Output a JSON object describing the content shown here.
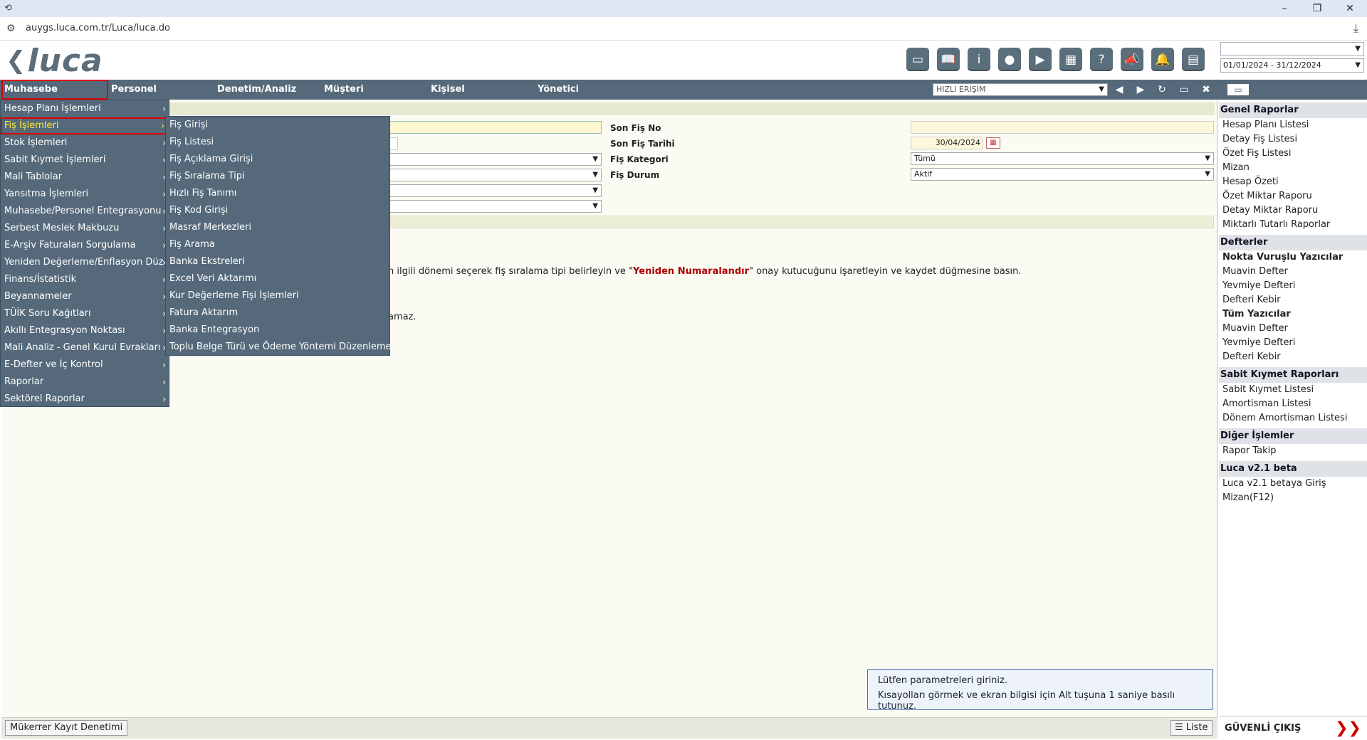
{
  "browser": {
    "url": "auygs.luca.com.tr/Luca/luca.do",
    "app_icon": "luca-app-icon"
  },
  "header": {
    "logo_text": "luca",
    "period_select_empty": "",
    "period_range": "01/01/2024 - 31/12/2024"
  },
  "toolbar": [
    {
      "name": "note-icon",
      "glyph": "▭"
    },
    {
      "name": "book-icon",
      "glyph": "📖"
    },
    {
      "name": "info-icon",
      "glyph": "i"
    },
    {
      "name": "globe-icon",
      "glyph": "●"
    },
    {
      "name": "youtube-icon",
      "glyph": "▶"
    },
    {
      "name": "calculator-icon",
      "glyph": "▦"
    },
    {
      "name": "help-icon",
      "glyph": "?"
    },
    {
      "name": "megaphone-icon",
      "glyph": "📣"
    },
    {
      "name": "bell-icon",
      "glyph": "🔔"
    },
    {
      "name": "notebook-icon",
      "glyph": "▤"
    }
  ],
  "menubar": {
    "items": [
      "Muhasebe",
      "Personel",
      "Denetim/Analiz",
      "Müşteri",
      "Kişisel",
      "Yönetici"
    ],
    "quick_access_placeholder": "HIZLI ERİŞİM"
  },
  "menu_level1": [
    {
      "label": "Hesap Planı İşlemleri",
      "sub": true
    },
    {
      "label": "Fiş İşlemleri",
      "sub": true,
      "active": true
    },
    {
      "label": "Stok İşlemleri",
      "sub": true
    },
    {
      "label": "Sabit Kıymet İşlemleri",
      "sub": true
    },
    {
      "label": "Mali Tablolar",
      "sub": true
    },
    {
      "label": "Yansıtma İşlemleri",
      "sub": true
    },
    {
      "label": "Muhasebe/Personel Entegrasyonu",
      "sub": true
    },
    {
      "label": "Serbest Meslek Makbuzu",
      "sub": true
    },
    {
      "label": "E-Arşiv Faturaları Sorgulama",
      "sub": true
    },
    {
      "label": "Yeniden Değerleme/Enflasyon Düz",
      "sub": true
    },
    {
      "label": "Finans/İstatistik",
      "sub": true
    },
    {
      "label": "Beyannameler",
      "sub": true
    },
    {
      "label": "TÜİK Soru Kağıtları",
      "sub": true
    },
    {
      "label": "Akıllı Entegrasyon Noktası",
      "sub": true
    },
    {
      "label": "Mali Analiz - Genel Kurul Evrakları",
      "sub": true
    },
    {
      "label": "E-Defter ve İç Kontrol",
      "sub": true
    },
    {
      "label": "Raporlar",
      "sub": true
    },
    {
      "label": "Sektörel Raporlar",
      "sub": true
    }
  ],
  "menu_level2": [
    "Fiş Girişi",
    "Fiş Listesi",
    "Fiş Açıklama Girişi",
    "Fiş Sıralama Tipi",
    "Hızlı Fiş Tanımı",
    "Fiş Kod Girişi",
    "Masraf Merkezleri",
    "Fiş Arama",
    "Banka Ekstreleri",
    "Excel Veri Aktarımı",
    "Kur Değerleme Fişi İşlemleri",
    "Fatura Aktarım",
    "Banka Entegrasyon",
    "Toplu Belge Türü ve Ödeme Yöntemi Düzenleme"
  ],
  "form": {
    "son_fis_no_label": "Son Fiş No",
    "son_fis_tarihi_label": "Son Fiş Tarihi",
    "son_fis_tarihi_value": "30/04/2024",
    "fis_kategori_label": "Fiş Kategori",
    "fis_kategori_value": "Tümü",
    "fis_durum_label": "Fiş Durum",
    "fis_durum_value": "Aktif",
    "hint_pre": "n ilgili dönemi seçerek fiş sıralama tipi belirleyin ve \"",
    "hint_bold": "Yeniden Numaralandır",
    "hint_post": "\" onay kutucuğunu işaretleyin ve kaydet düğmesine basın.",
    "hint2": "amaz."
  },
  "infobox": {
    "line1": "Lütfen parametreleri giriniz.",
    "line2": "Kısayolları görmek ve ekran bilgisi için Alt tuşuna 1 saniye basılı tutunuz."
  },
  "bottombar": {
    "dup_check": "Mükerrer Kayıt Denetimi",
    "list": "Liste"
  },
  "rightpanel": {
    "sections": [
      {
        "title": "Genel Raporlar",
        "items": [
          {
            "label": "Hesap Planı Listesi"
          },
          {
            "label": "Detay Fiş Listesi"
          },
          {
            "label": "Özet Fiş Listesi"
          },
          {
            "label": "Mizan"
          },
          {
            "label": "Hesap Özeti"
          },
          {
            "label": "Özet Miktar Raporu"
          },
          {
            "label": "Detay Miktar Raporu"
          },
          {
            "label": "Miktarlı Tutarlı Raporlar"
          }
        ]
      },
      {
        "title": "Defterler",
        "items": [
          {
            "label": "Nokta Vuruşlu Yazıcılar",
            "bold": true
          },
          {
            "label": "Muavin Defter"
          },
          {
            "label": "Yevmiye Defteri"
          },
          {
            "label": "Defteri Kebir"
          },
          {
            "label": "Tüm Yazıcılar",
            "bold": true
          },
          {
            "label": "Muavin Defter"
          },
          {
            "label": "Yevmiye Defteri"
          },
          {
            "label": "Defteri Kebir"
          }
        ]
      },
      {
        "title": "Sabit Kıymet Raporları",
        "items": [
          {
            "label": "Sabit Kıymet Listesi"
          },
          {
            "label": "Amortisman Listesi"
          },
          {
            "label": "Dönem Amortisman Listesi"
          }
        ]
      },
      {
        "title": "Diğer İşlemler",
        "items": [
          {
            "label": "Rapor Takip"
          }
        ]
      },
      {
        "title": "Luca v2.1 beta",
        "items": [
          {
            "label": "Luca v2.1 betaya Giriş"
          },
          {
            "label": "Mizan(F12)"
          }
        ]
      }
    ],
    "logout": "GÜVENLİ ÇIKIŞ"
  }
}
